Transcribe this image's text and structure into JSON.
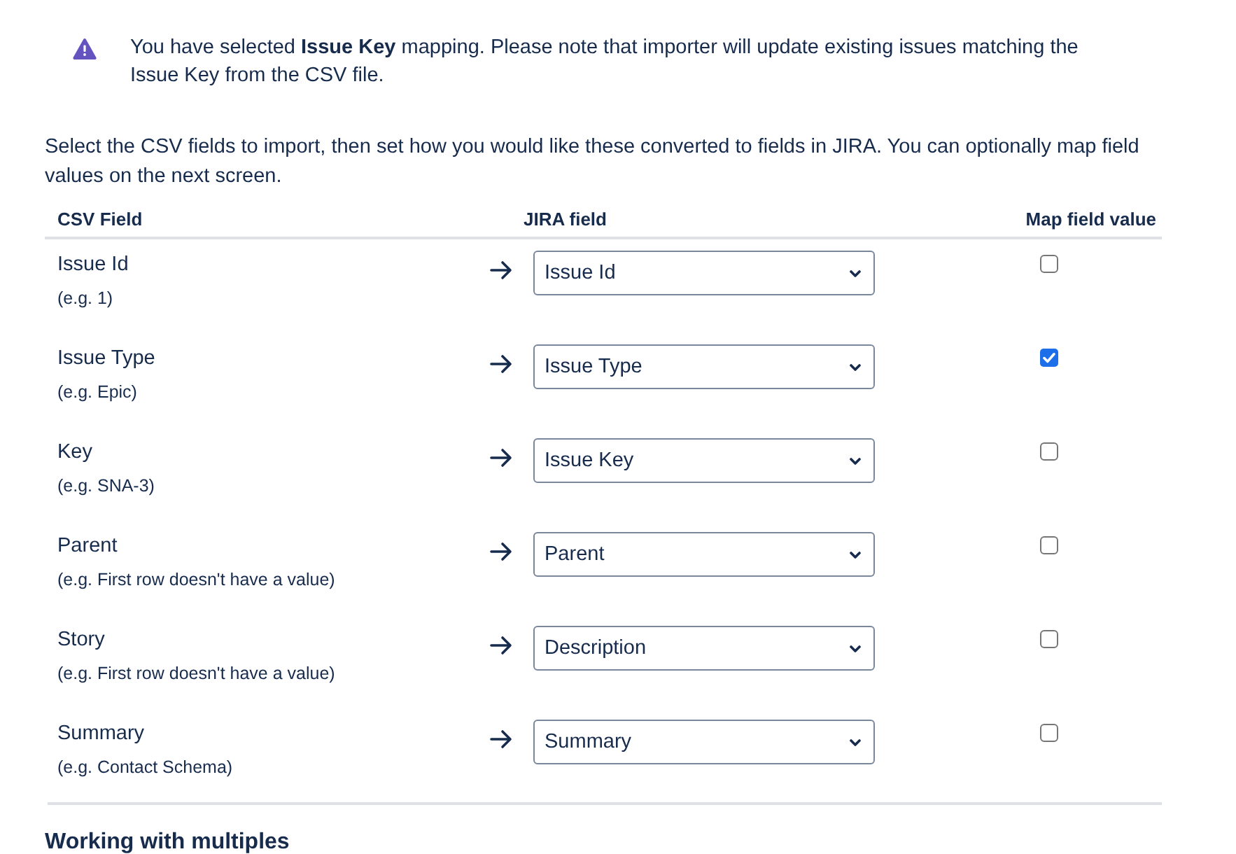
{
  "notice": {
    "text": "You have selected **Issue Key** mapping. Please note that importer will update existing issues matching the Issue Key from the CSV file."
  },
  "intro": {
    "text": "Select the CSV fields to import, then set how you would like these converted to fields in JIRA. You can optionally map field values on the next screen."
  },
  "table": {
    "columns": [
      "CSV Field",
      "JIRA field",
      "Map field value"
    ],
    "rows": [
      {
        "csv_field": "Issue Id",
        "example": "(e.g. 1)",
        "jira_field": "Issue Id",
        "checked": false
      },
      {
        "csv_field": "Issue Type",
        "example": "(e.g. Epic)",
        "jira_field": "Issue Type",
        "checked": true
      },
      {
        "csv_field": "Key",
        "example": "(e.g. SNA-3)",
        "jira_field": "Issue Key",
        "checked": false
      },
      {
        "csv_field": "Parent",
        "example": "(e.g. First row doesn't have a value)",
        "jira_field": "Parent",
        "checked": false
      },
      {
        "csv_field": "Story",
        "example": "(e.g. First row doesn't have a value)",
        "jira_field": "Description",
        "checked": false
      },
      {
        "csv_field": "Summary",
        "example": "(e.g. Contact Schema)",
        "jira_field": "Summary",
        "checked": false
      }
    ]
  },
  "next_section": {
    "heading": "Working with multiples"
  }
}
